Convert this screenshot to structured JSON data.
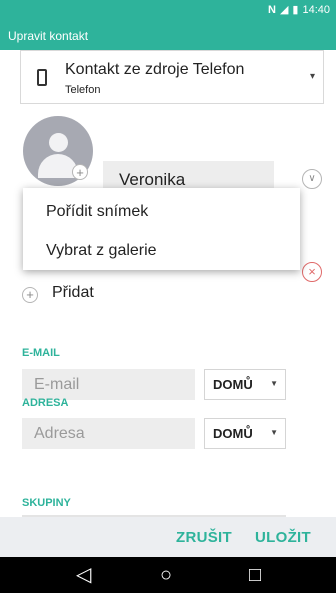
{
  "status_bar": {
    "time": "14:40",
    "nfc": "N",
    "battery": "▮",
    "signal": "◢"
  },
  "app_bar": {
    "title": "Upravit kontakt"
  },
  "account": {
    "title": "Kontakt ze zdroje Telefon",
    "subtitle": "Telefon",
    "icon": "phone-icon"
  },
  "name": {
    "value": "Veronika"
  },
  "popup": {
    "items": [
      "Pořídit snímek",
      "Vybrat z galerie"
    ]
  },
  "add": {
    "label": "Přidat"
  },
  "email": {
    "section": "E-MAIL",
    "placeholder": "E-mail",
    "type": "DOMŮ"
  },
  "address": {
    "section": "ADRESA",
    "placeholder": "Adresa",
    "type": "DOMŮ"
  },
  "groups": {
    "section": "SKUPINY"
  },
  "actions": {
    "cancel": "ZRUŠIT",
    "save": "ULOŽIT"
  },
  "nav": {
    "back": "◁",
    "home": "○",
    "recents": "□"
  },
  "colors": {
    "accent": "#2eb39b",
    "remove": "#e06a6a"
  }
}
